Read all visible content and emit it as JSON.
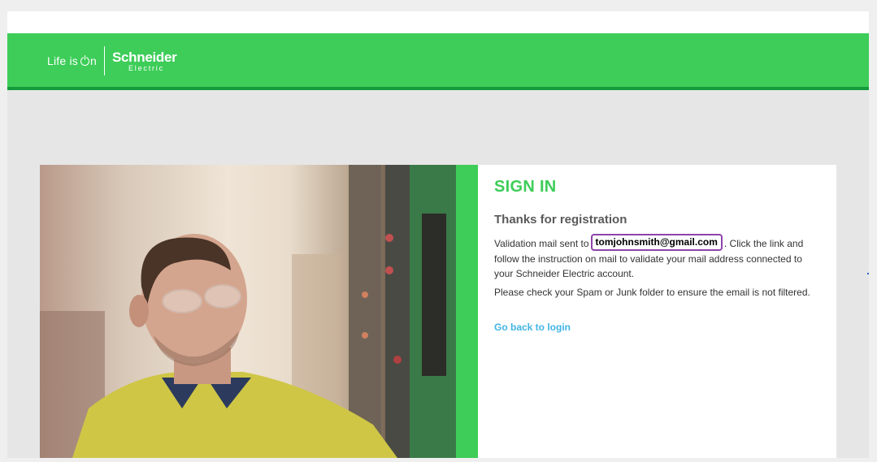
{
  "header": {
    "tagline_prefix": "Life is ",
    "tagline_suffix": "n",
    "logo_name": "Schneider",
    "logo_sub": "Electric"
  },
  "photo": {
    "icon": "worker-photo"
  },
  "signin": {
    "title": "SIGN IN",
    "subtitle": "Thanks for registration",
    "validation_prefix": "Validation mail sent to",
    "email": "tomjohnsmith@gmail.com",
    "validation_suffix": ". Click the link and follow the instruction on mail to validate your mail address connected to your Schneider Electric account.",
    "spam_note": "Please check your Spam or Junk folder to ensure the email is not filtered.",
    "back_link": "Go back to login"
  },
  "colors": {
    "brand_green": "#3dcd58",
    "dark_green": "#169b3c",
    "link_blue": "#42b4e6",
    "highlight_purple": "#8e44a8"
  }
}
